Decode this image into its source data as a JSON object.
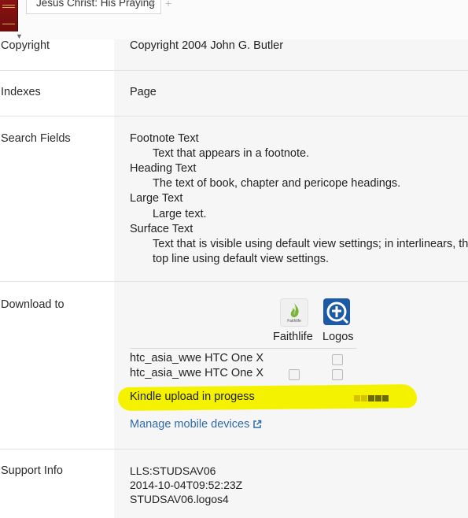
{
  "tab": {
    "title": "Jesus Christ: His Praying",
    "close_glyph": "×",
    "new_tab_glyph": "+"
  },
  "rows": {
    "copyright": {
      "label": "Copyright",
      "value": "Copyright 2004 John G. Butler"
    },
    "indexes": {
      "label": "Indexes",
      "value": "Page"
    },
    "search_fields": {
      "label": "Search Fields",
      "items": [
        {
          "name": "Footnote Text",
          "desc": "Text that appears in a footnote."
        },
        {
          "name": "Heading Text",
          "desc": "The text of book, chapter and pericope headings."
        },
        {
          "name": "Large Text",
          "desc": "Large text."
        },
        {
          "name": "Surface Text",
          "desc": "Text that is visible using default view settings; in interlinears, th",
          "desc2": "top line using default view settings."
        }
      ]
    },
    "download": {
      "label": "Download to",
      "apps": [
        {
          "name": "Faithlife",
          "icon_caption": "Faithlife",
          "icon": "faithlife-flame-icon",
          "color": "#7ab23a"
        },
        {
          "name": "Logos",
          "icon": "logos-cross-icon",
          "color": "#1b5aa6"
        }
      ],
      "devices": [
        {
          "name": "htc_asia_wwe HTC One X",
          "checkboxes": [
            false,
            false
          ]
        },
        {
          "name": "htc_asia_wwe HTC One X",
          "checkboxes": [
            false,
            false
          ]
        }
      ],
      "kindle_status": "Kindle upload in progess",
      "progress_fraction": 0.6,
      "manage_link": "Manage mobile devices",
      "highlight_color": "#f5f200"
    },
    "support": {
      "label": "Support Info",
      "lines": [
        "LLS:STUDSAV06",
        "2014-10-04T09:52:23Z",
        "STUDSAV06.logos4"
      ]
    }
  },
  "colors": {
    "link": "#2f6aa8",
    "value_column_bg": "#f6f6f6",
    "book_cover": "#8a1313"
  }
}
